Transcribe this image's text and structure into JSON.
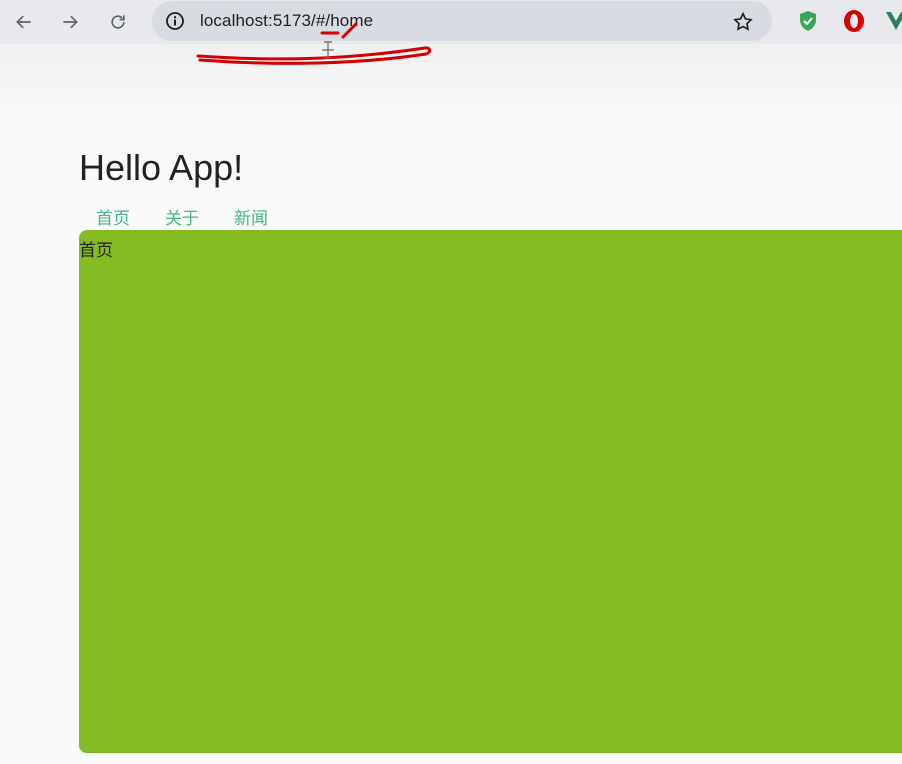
{
  "browser": {
    "url": "localhost:5173/#/home",
    "extensions": [
      "shield-extension",
      "opera-extension",
      "vue-devtools-extension"
    ]
  },
  "app": {
    "title": "Hello App!",
    "nav": [
      {
        "label": "首页"
      },
      {
        "label": "关于"
      },
      {
        "label": "新闻"
      }
    ],
    "view": {
      "text": "首页",
      "background_color": "#86bc23"
    },
    "link_color": "#42b883"
  },
  "annotation": {
    "color": "#d40000"
  }
}
